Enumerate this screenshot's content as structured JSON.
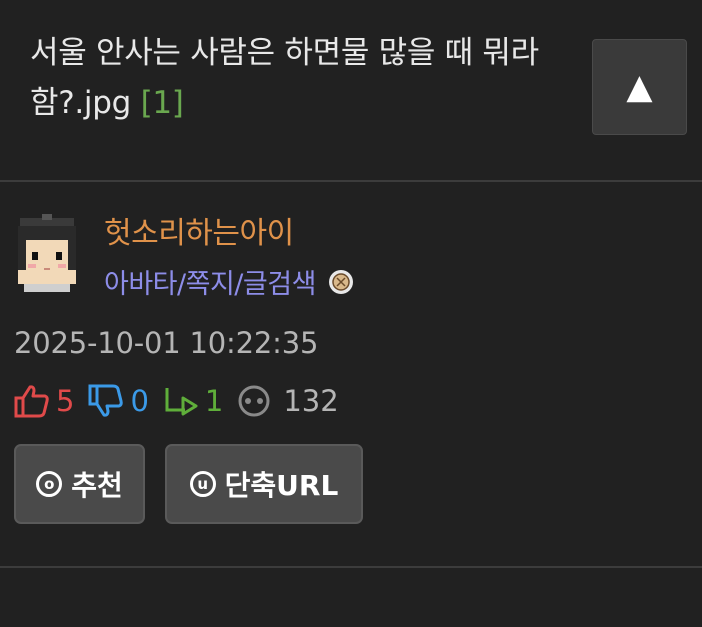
{
  "post": {
    "title": "서울 안사는 사람은 하면물 많을 때 뭐라함?.jpg",
    "comment_count": "[1]"
  },
  "top_button": {
    "icon": "up-arrow-icon",
    "glyph": "▲"
  },
  "author": {
    "nickname": "헛소리하는아이",
    "links": "아바타/쪽지/글검색"
  },
  "timestamp": "2025-10-01 10:22:35",
  "stats": {
    "upvotes": "5",
    "downvotes": "0",
    "replies": "1",
    "views": "132"
  },
  "buttons": {
    "recommend_icon": "ⓞ",
    "recommend": "추천",
    "shorturl_icon": "ⓤ",
    "shorturl": "단축URL"
  },
  "colors": {
    "background": "#212121",
    "nickname": "#e0924a",
    "links": "#8d8de8",
    "upvote": "#e04a4a",
    "downvote": "#3b9ae8",
    "reply": "#5fae3a",
    "comment_count": "#6aa84f"
  }
}
